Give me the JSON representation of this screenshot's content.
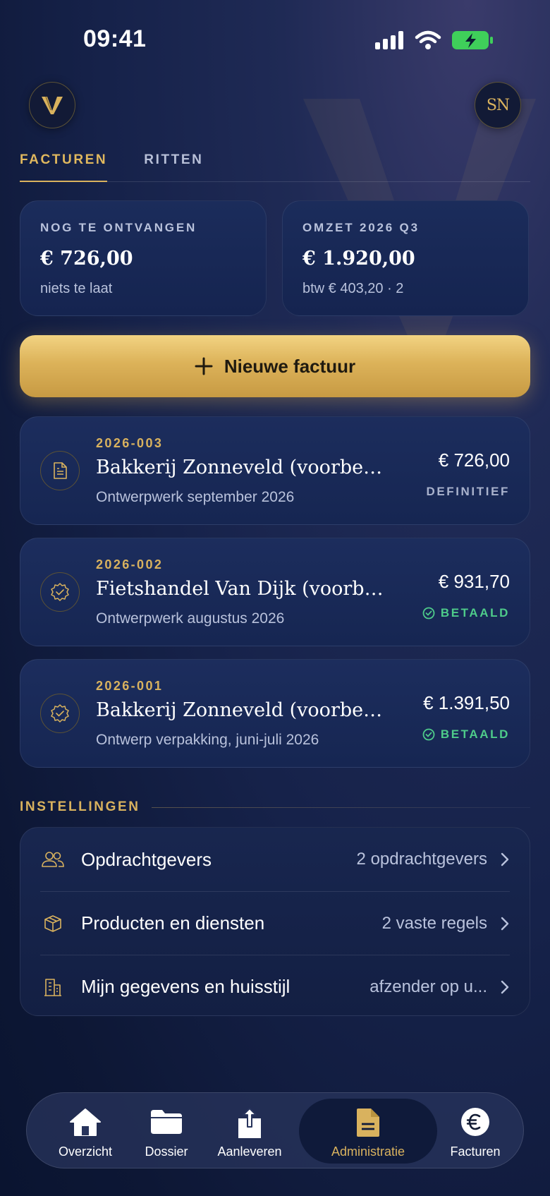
{
  "status_bar": {
    "time": "09:41"
  },
  "header": {
    "logo_letter": "V",
    "avatar_initials": "SN"
  },
  "tabs": [
    {
      "label": "FACTUREN",
      "active": true
    },
    {
      "label": "RITTEN",
      "active": false
    }
  ],
  "stats": [
    {
      "label": "NOG TE ONTVANGEN",
      "value": "€ 726,00",
      "sub": "niets te laat"
    },
    {
      "label": "OMZET 2026 Q3",
      "value": "€ 1.920,00",
      "sub": "btw € 403,20 · 2"
    }
  ],
  "new_invoice": {
    "label": "Nieuwe factuur"
  },
  "invoices": [
    {
      "number": "2026-003",
      "client": "Bakkerij Zonneveld (voorbeeld)",
      "description": "Ontwerpwerk september 2026",
      "amount": "€ 726,00",
      "status": "DEFINITIEF",
      "icon": "document-icon"
    },
    {
      "number": "2026-002",
      "client": "Fietshandel Van Dijk (voorbee...",
      "description": "Ontwerpwerk augustus 2026",
      "amount": "€ 931,70",
      "status": "BETAALD",
      "icon": "verified-badge-icon"
    },
    {
      "number": "2026-001",
      "client": "Bakkerij Zonneveld (voorbeeld)",
      "description": "Ontwerp verpakking, juni-juli 2026",
      "amount": "€ 1.391,50",
      "status": "BETAALD",
      "icon": "verified-badge-icon"
    }
  ],
  "settings": {
    "title": "INSTELLINGEN",
    "rows": [
      {
        "label": "Opdrachtgevers",
        "value": "2 opdrachtgevers",
        "icon": "users-icon"
      },
      {
        "label": "Producten en diensten",
        "value": "2 vaste regels",
        "icon": "box-icon"
      },
      {
        "label": "Mijn gegevens en huisstijl",
        "value": "afzender op u...",
        "icon": "building-icon"
      }
    ]
  },
  "nav": [
    {
      "label": "Overzicht",
      "icon": "home-icon",
      "active": false
    },
    {
      "label": "Dossier",
      "icon": "folder-icon",
      "active": false
    },
    {
      "label": "Aanleveren",
      "icon": "upload-icon",
      "active": false
    },
    {
      "label": "Administratie",
      "icon": "document-icon",
      "active": true
    },
    {
      "label": "Facturen",
      "icon": "euro-icon",
      "active": false
    }
  ],
  "colors": {
    "accent_gold": "#d9b25e",
    "paid_green": "#4ecb8a",
    "background": "#16224a"
  }
}
